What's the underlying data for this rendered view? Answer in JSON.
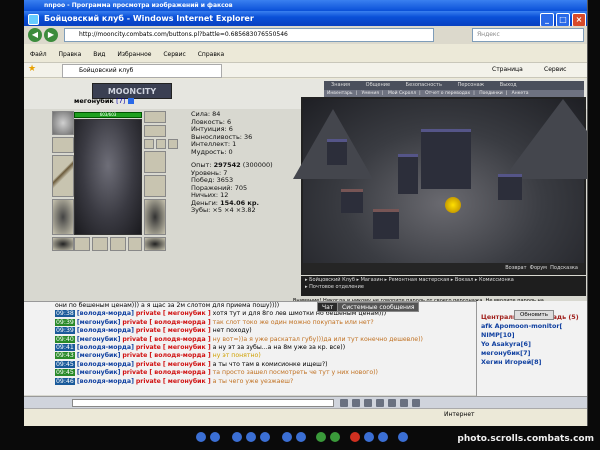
{
  "window": {
    "title": "nnpoo - Программа просмотра изображений и факсов",
    "ie_title": "Бойцовский клуб - Windows Internet Explorer"
  },
  "browser": {
    "url": "http://mooncity.combats.com/buttons.pl?battle=0.685683076550546",
    "search_placeholder": "Яндекс",
    "menu": [
      "Файл",
      "Правка",
      "Вид",
      "Избранное",
      "Сервис",
      "Справка"
    ],
    "tab_label": "Бойцовский клуб",
    "cmd": [
      "Страница",
      "Сервис"
    ],
    "status": "Интернет"
  },
  "game": {
    "logo": "MOONCITY",
    "top_nav": [
      "Знания",
      "Общение",
      "Безопасность",
      "Персонаж",
      "Выход"
    ],
    "sub_nav": [
      "Инвентарь",
      "Умения",
      "Мой Скролл",
      "Отчет о переводах",
      "Поединки",
      "Анкета"
    ],
    "char": {
      "name": "мегонубик",
      "level": "[7]",
      "hp": "603/603"
    },
    "stats": [
      "Сила: 84",
      "Ловкость: 6",
      "Интуиция: 6",
      "Выносливость: 36",
      "Интеллект: 1",
      "Мудрость: 0"
    ],
    "exp_label": "Опыт:",
    "exp": "297542",
    "exp_next": "(300000)",
    "info": [
      "Уровень: 7",
      "Побед: 3653",
      "Поражений: 705",
      "Ничьих: 12"
    ],
    "money_label": "Деньги:",
    "money": "154.06 кр.",
    "teeth": "Зубы: ×5 ×4 ×3.82",
    "scene_links": [
      "Возврат",
      "Форум",
      "Подсказка"
    ],
    "loc_links": [
      "Бойцовский Клуб",
      "Магазин",
      "Ремонтная мастерская",
      "Вокзал",
      "Комиссионка",
      "Почтовое отделение"
    ],
    "warn": "Внимание! Никогда и никому не говорите пароль от своего персонажа. Не вводите пароль на"
  },
  "chat": {
    "tabs": [
      "Чат",
      "Системные сообщения"
    ],
    "lines": [
      {
        "time": "",
        "from": "",
        "to": "",
        "msg": "они по бешеным ценам))) а я щас за 2м слотом для приема пошу))))",
        "cls": "m"
      },
      {
        "time": "09:38",
        "from": "[володя-морда]",
        "to": "[ мегонубик ]",
        "msg": "хотя тут и для 8го лев шмотки но бешеным ценам)))",
        "cls": "m"
      },
      {
        "time": "09:39",
        "from": "[мегонубик]",
        "to": "[ володя-морда ]",
        "msg": "так слот токо же один можно покупать или нет?",
        "cls": "m2"
      },
      {
        "time": "09:39",
        "from": "[володя-морда]",
        "to": "[ мегонубик ]",
        "msg": "нет походу)",
        "cls": "m"
      },
      {
        "time": "09:40",
        "from": "[мегонубик]",
        "to": "[ володя-морда ]",
        "msg": "ну вот=))а я уже раскатал губу)))да или тут конечно дешевле))",
        "cls": "m2"
      },
      {
        "time": "09:41",
        "from": "[володя-морда]",
        "to": "[ мегонубик ]",
        "msg": "а ну эт за зубы...а на 8м уже за кр. все))",
        "cls": "m"
      },
      {
        "time": "09:43",
        "from": "[мегонубик]",
        "to": "[ володя-морда ]",
        "msg": "ну эт понятно)",
        "cls": "m3"
      },
      {
        "time": "09:45",
        "from": "[володя-морда]",
        "to": "[ мегонубик ]",
        "msg": "а ты что там в комисионке ищеш?)",
        "cls": "m"
      },
      {
        "time": "09:45",
        "from": "[мегонубик]",
        "to": "[ володя-морда ]",
        "msg": "та просто зашел посмотреть че тут у них нового))",
        "cls": "m2"
      },
      {
        "time": "09:46",
        "from": "[володя-морда]",
        "to": "[ мегонубик ]",
        "msg": "а ты чего уже уезжаеш?",
        "cls": "m2"
      }
    ],
    "private": "private"
  },
  "online": {
    "title": "Центральная площадь (5)",
    "users": [
      "afk Apomoon-monitor[",
      "NIMP[10]",
      "Yo Asakyra[6]",
      "мегонубик[7]",
      "Хегин Игорей[8]"
    ],
    "refresh": "Обновить"
  },
  "viewer": {
    "watermark": "photo.scrolls.combats.com"
  }
}
